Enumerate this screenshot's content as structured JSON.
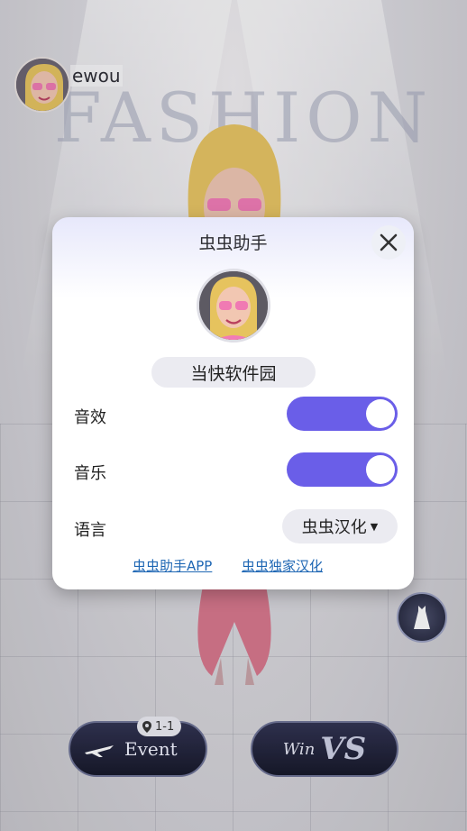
{
  "background": {
    "player_name": "ewou",
    "banner_text": "FASHION",
    "event_label": "Event",
    "level_badge": "1-1",
    "vs_left_text": "Win",
    "vs_label": "VS"
  },
  "dialog": {
    "title": "虫虫助手",
    "username": "当快软件园",
    "sound_effects": {
      "label": "音效",
      "enabled": true
    },
    "music": {
      "label": "音乐",
      "enabled": true
    },
    "language": {
      "label": "语言",
      "value": "虫虫汉化"
    },
    "links": [
      {
        "label": "虫虫助手APP"
      },
      {
        "label": "虫虫独家汉化"
      }
    ]
  },
  "colors": {
    "toggle_on": "#6a5ee8",
    "link": "#1f67b4"
  },
  "icons": {
    "close": "close-icon",
    "location": "location-pin-icon",
    "plane": "plane-icon",
    "dress": "dress-icon",
    "caret": "caret-down-icon"
  }
}
